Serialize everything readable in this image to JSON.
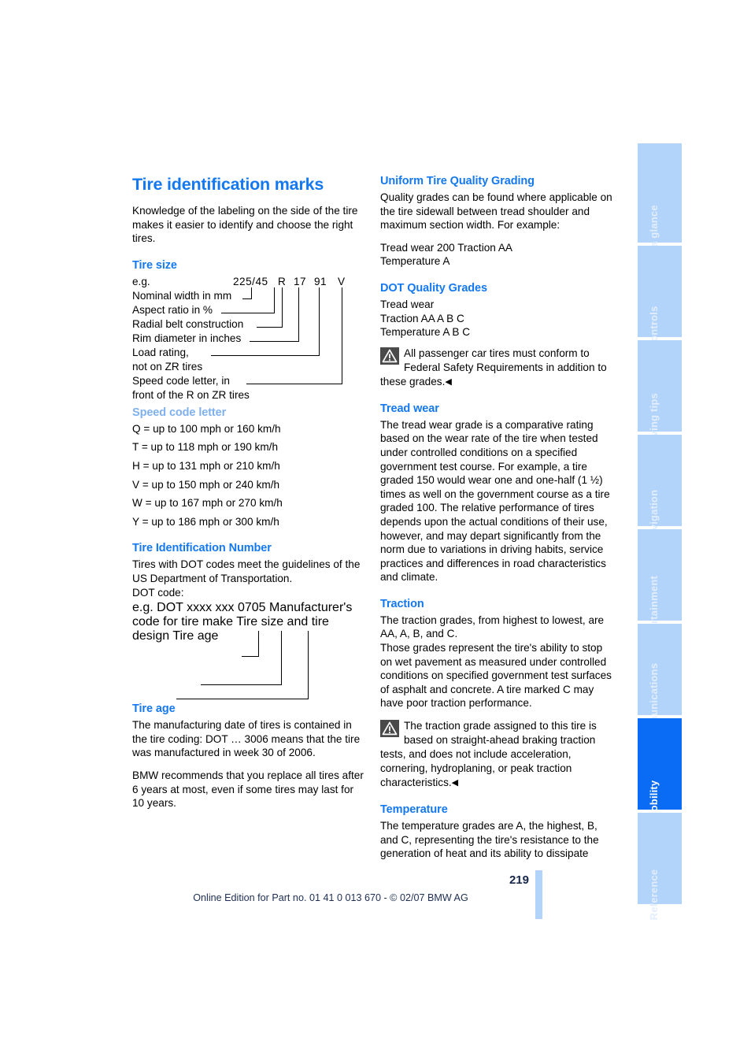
{
  "document": {
    "page_number": "219",
    "footer": "Online Edition for Part no. 01 41 0 013 670 - © 02/07 BMW AG"
  },
  "left_column": {
    "title": "Tire identification marks",
    "intro": "Knowledge of the labeling on the side of the tire makes it easier to identify and choose the right tires.",
    "tire_size": {
      "heading": "Tire size",
      "eg_label": "e.g.",
      "code_parts": {
        "nominal": "225/45",
        "radial": "R",
        "rim": "17",
        "load": "91",
        "speed": "V"
      },
      "labels": [
        "Nominal width in mm",
        "Aspect ratio in %",
        "Radial belt construction",
        "Rim diameter in inches",
        "Load rating,",
        "not on ZR tires",
        "Speed code letter, in",
        "front of the R on ZR tires"
      ]
    },
    "speed_code": {
      "heading": "Speed code letter",
      "rows": [
        "Q = up to 100 mph or 160 km/h",
        "T = up to 118 mph or 190 km/h",
        "H = up to 131 mph or 210 km/h",
        "V = up to 150 mph or 240 km/h",
        "W = up to 167 mph or 270 km/h",
        "Y = up to 186 mph or 300 km/h"
      ]
    },
    "tin": {
      "heading": "Tire Identification Number",
      "body": "Tires with DOT codes meet the guidelines of the US Department of Transportation.",
      "dot_code_label": "DOT code:",
      "eg_label": "e.g.",
      "dot_example": "DOT xxxx xxx 0705",
      "labels": [
        "Manufacturer's code",
        "for tire make",
        "Tire size and",
        "tire design",
        "Tire age"
      ]
    },
    "tire_age": {
      "heading": "Tire age",
      "paragraph1": "The manufacturing date of tires is contained in the tire coding: DOT … 3006 means that the tire was manufactured in week 30 of 2006.",
      "paragraph2": "BMW recommends that you replace all tires after 6 years at most, even if some tires may last for 10 years."
    }
  },
  "right_column": {
    "utqg": {
      "heading": "Uniform Tire Quality Grading",
      "body": "Quality grades can be found where applicable on the tire sidewall between tread shoulder and maximum section width. For example:",
      "example_line1": "Tread wear 200 Traction AA",
      "example_line2": "Temperature A"
    },
    "dot_quality": {
      "heading": "DOT Quality Grades",
      "line1": "Tread wear",
      "line2": "Traction AA A B C",
      "line3": "Temperature A B C",
      "warning": "All passenger car tires must conform to Federal Safety Requirements in addition to these grades.",
      "endmark": "◀"
    },
    "tread_wear": {
      "heading": "Tread wear",
      "body": "The tread wear grade is a comparative rating based on the wear rate of the tire when tested under controlled conditions on a specified government test course. For example, a tire graded 150 would wear one and one-half (1 ½) times as well on the government course as a tire graded 100. The relative performance of tires depends upon the actual conditions of their use, however, and may depart significantly from the norm due to variations in driving habits, service practices and differences in road characteristics and climate."
    },
    "traction": {
      "heading": "Traction",
      "body1": "The traction grades, from highest to lowest, are AA, A, B, and C.",
      "body2": "Those grades represent the tire's ability to stop on wet pavement as measured under controlled conditions on specified government test surfaces of asphalt and concrete. A tire marked C may have poor traction performance.",
      "warning": "The traction grade assigned to this tire is based on straight-ahead braking traction tests, and does not include acceleration, cornering, hydroplaning, or peak traction characteristics.",
      "endmark": "◀"
    },
    "temperature": {
      "heading": "Temperature",
      "body": "The temperature grades are A, the highest, B, and C, representing the tire's resistance to the generation of heat and its ability to dissipate"
    }
  },
  "tabs": [
    {
      "label": "At a glance",
      "active": false
    },
    {
      "label": "Controls",
      "active": false
    },
    {
      "label": "Driving tips",
      "active": false
    },
    {
      "label": "Navigation",
      "active": false
    },
    {
      "label": "Entertainment",
      "active": false
    },
    {
      "label": "Communications",
      "active": false
    },
    {
      "label": "Mobility",
      "active": true
    },
    {
      "label": "Reference",
      "active": false
    }
  ],
  "colors": {
    "heading_blue": "#1478F0",
    "muted_blue": "#7FB0EF",
    "tab_blue": "#B2D3FA",
    "tab_active_blue": "#0A6CF5",
    "footer_navy": "#1D2E52"
  }
}
